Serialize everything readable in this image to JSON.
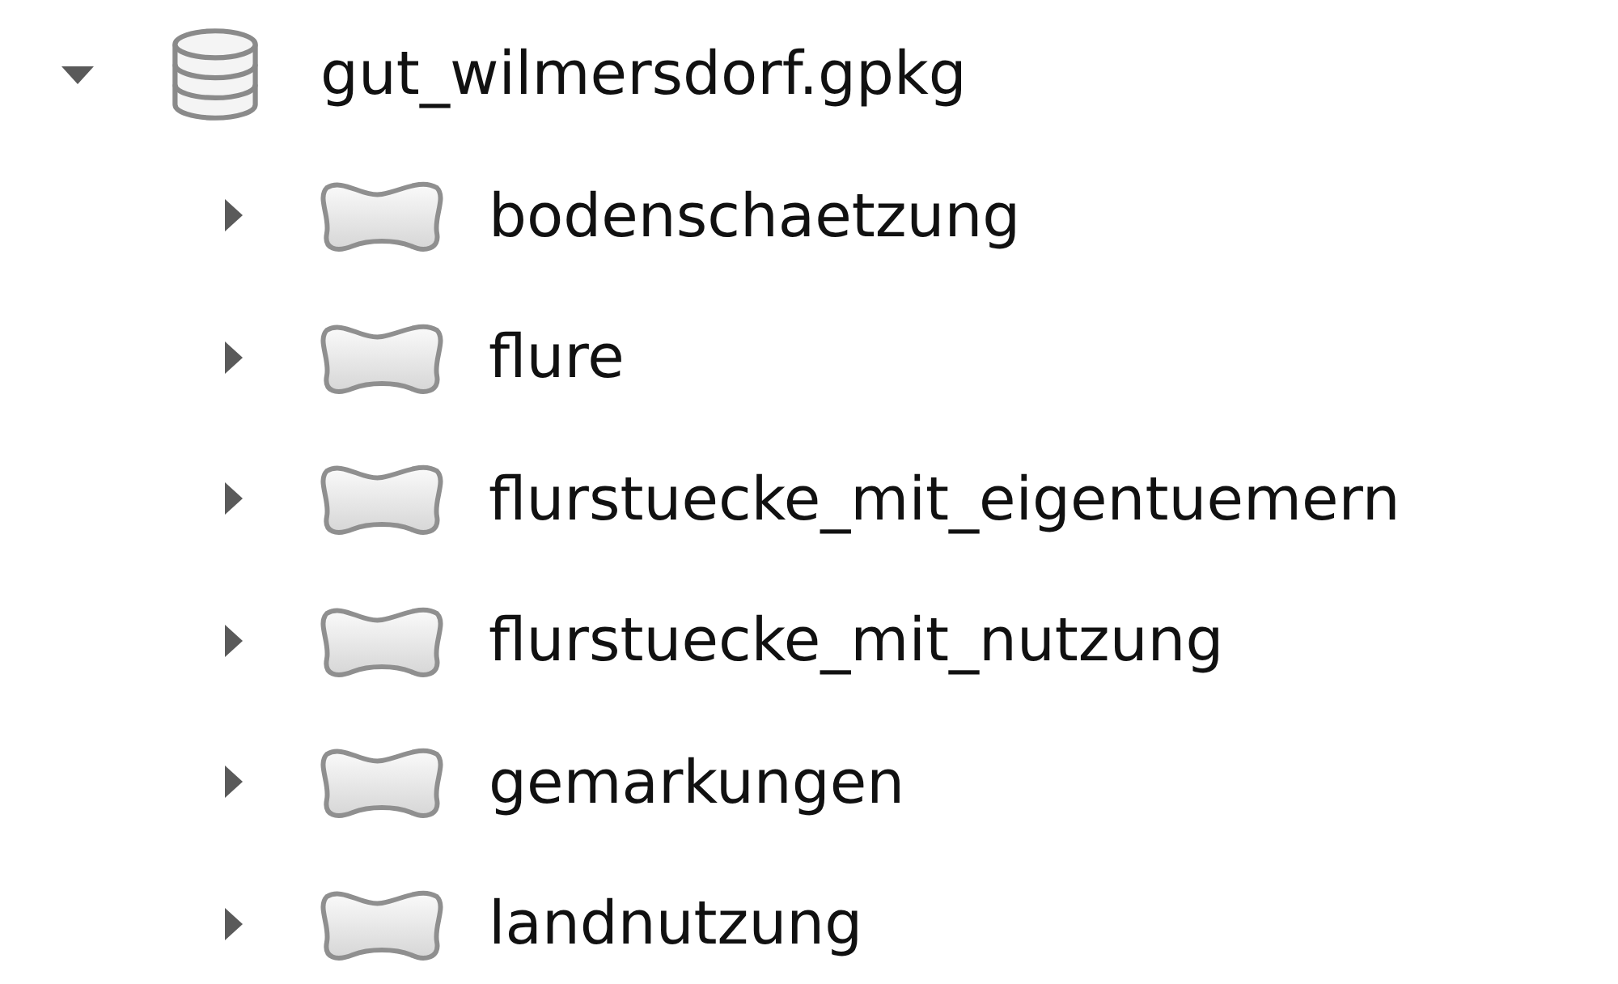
{
  "tree": [
    {
      "name": "gut_wilmersdorf.gpkg",
      "kind": "database",
      "expanded": true,
      "children": [
        {
          "name": "bodenschaetzung",
          "kind": "polygon-layer",
          "expanded": false
        },
        {
          "name": "flure",
          "kind": "polygon-layer",
          "expanded": false
        },
        {
          "name": "flurstuecke_mit_eigentuemern",
          "kind": "polygon-layer",
          "expanded": false
        },
        {
          "name": "flurstuecke_mit_nutzung",
          "kind": "polygon-layer",
          "expanded": false
        },
        {
          "name": "gemarkungen",
          "kind": "polygon-layer",
          "expanded": false
        },
        {
          "name": "landnutzung",
          "kind": "polygon-layer",
          "expanded": false
        }
      ]
    }
  ]
}
